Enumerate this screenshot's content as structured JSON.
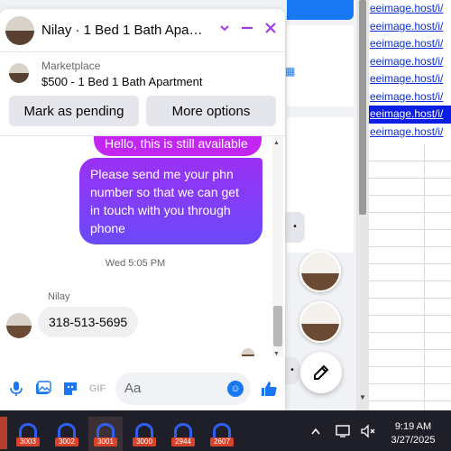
{
  "chat": {
    "title": "Nilay · 1 Bed 1 Bath Apart…",
    "header_icons": {
      "chevron": "chevron-down-icon",
      "minimize": "minimize-icon",
      "close": "close-icon"
    },
    "marketplace": {
      "label": "Marketplace",
      "listing": "$500 - 1 Bed 1 Bath Apartment",
      "buttons": [
        "Mark as pending",
        "More options"
      ]
    },
    "messages": {
      "outgoing_1": "Hello, this is still available",
      "outgoing_2": "Please send me your phn number so that we can get in touch with you through phone",
      "timestamp": "Wed 5:05 PM",
      "sender_name": "Nilay",
      "incoming_1": "318-513-5695"
    },
    "composer": {
      "placeholder": "Aa",
      "gif_label": "GIF",
      "icons": [
        "microphone-icon",
        "photo-icon",
        "sticker-icon",
        "gif-icon",
        "emoji-icon",
        "like-icon"
      ]
    }
  },
  "background": {
    "links": [
      "eeimage.host/i/",
      "eeimage.host/i/",
      "eeimage.host/i/",
      "eeimage.host/i/",
      "eeimage.host/i/",
      "eeimage.host/i/",
      "eeimage.host/i/",
      "eeimage.host/i/"
    ]
  },
  "taskbar": {
    "badges": [
      "3003",
      "3002",
      "3001",
      "3000",
      "2944",
      "2607"
    ],
    "active_index": 2,
    "time": "9:19 AM",
    "date": "3/27/2025"
  },
  "colors": {
    "accent": "#a33be9",
    "messenger_blue": "#1877f2",
    "bubble_purple": "#8a3cf6"
  }
}
